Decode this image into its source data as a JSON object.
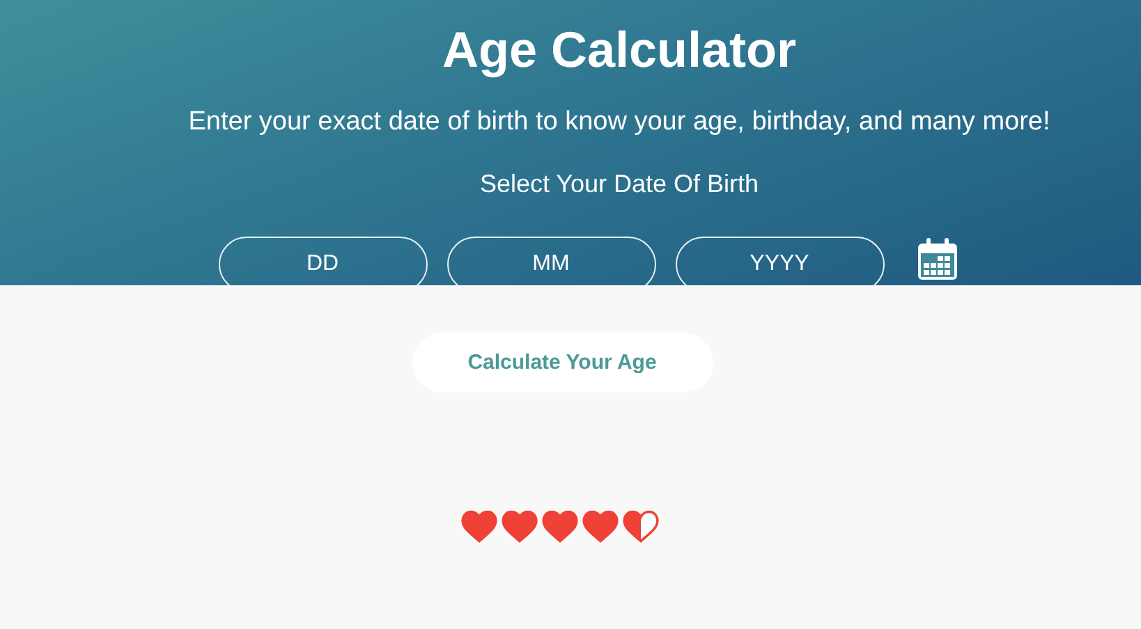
{
  "header": {
    "title": "Age Calculator",
    "subtitle": "Enter your exact date of birth to know your age, birthday, and many more!",
    "prompt": "Select Your Date Of Birth"
  },
  "date_fields": [
    {
      "placeholder": "DD"
    },
    {
      "placeholder": "MM"
    },
    {
      "placeholder": "YYYY"
    }
  ],
  "calculate_button": "Calculate Your Age",
  "rating": {
    "stars": 4.5
  }
}
